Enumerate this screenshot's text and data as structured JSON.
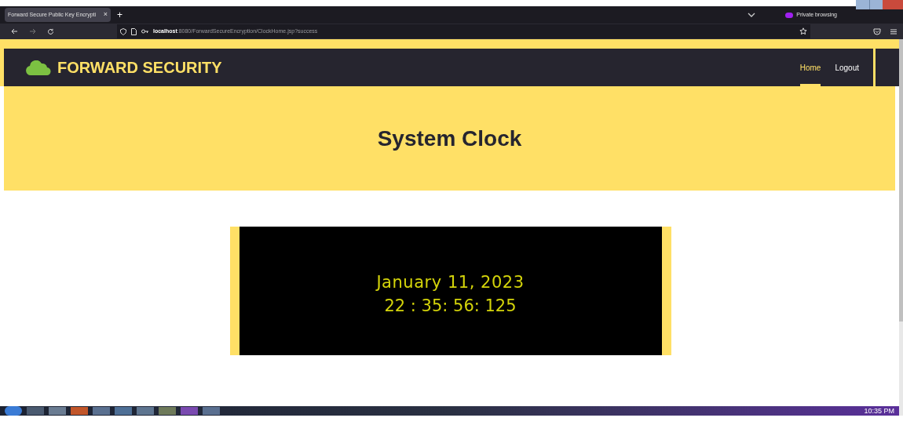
{
  "browser": {
    "tab_title": "Forward Secure Public Key Encrypti",
    "tab_close": "×",
    "new_tab": "+",
    "private_label": "Private browsing",
    "url_host": "localhost",
    "url_rest": ":8080/ForwardSecureEncryption/ClockHome.jsp?success"
  },
  "navbar": {
    "brand": "FORWARD SECURITY",
    "links": [
      {
        "label": "Home",
        "selected": true
      },
      {
        "label": "Logout",
        "selected": false
      }
    ]
  },
  "hero": {
    "title": "System Clock"
  },
  "clock": {
    "date": "January 11, 2023",
    "time": "22 : 35: 56: 125"
  },
  "taskbar": {
    "time": "10:35 PM"
  }
}
